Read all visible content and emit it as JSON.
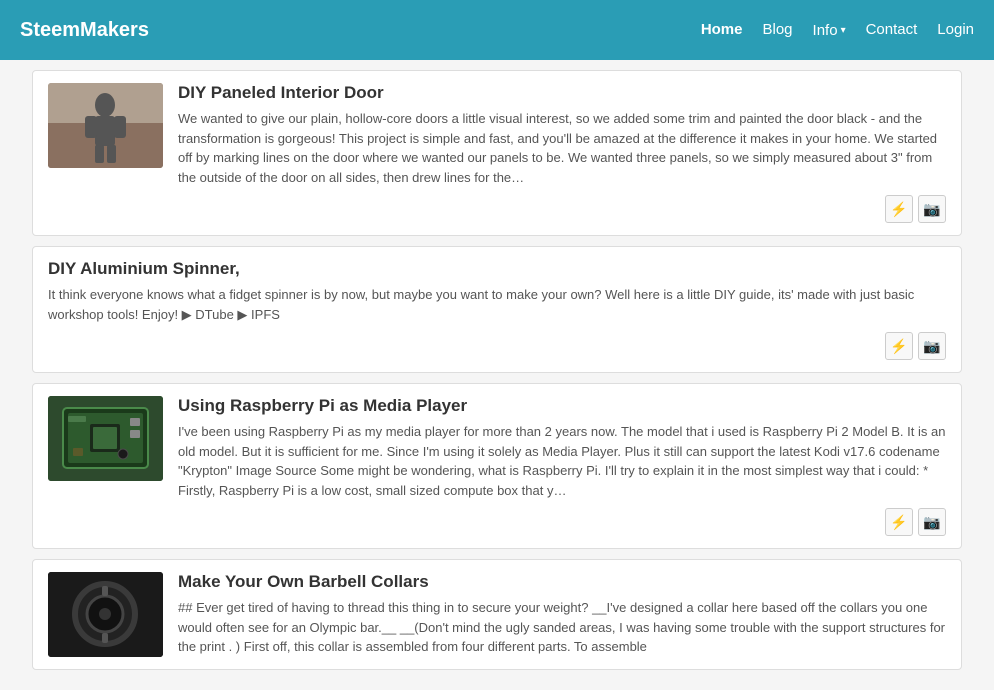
{
  "brand": "SteemMakers",
  "nav": {
    "home": "Home",
    "blog": "Blog",
    "info": "Info",
    "contact": "Contact",
    "login": "Login"
  },
  "posts": [
    {
      "id": "diy-paneled-door",
      "title": "DIY Paneled Interior Door",
      "excerpt": "We wanted to give our plain, hollow-core doors a little visual interest, so we added some trim and painted the door black - and the transformation is gorgeous! This project is simple and fast, and you'll be amazed at the difference it makes in your home. We started off by marking lines on the door where we wanted our panels to be. We wanted three panels, so we simply measured about 3\" from the outside of the door on all sides, then drew lines for the…",
      "has_thumbnail": true,
      "thumbnail_type": "woodwork",
      "actions": [
        "bolt",
        "camera"
      ]
    },
    {
      "id": "diy-aluminium-spinner",
      "title": "DIY Aluminium Spinner,",
      "excerpt": "It think everyone knows what a fidget spinner is by now, but maybe you want to make your own? Well here is a little DIY guide, its' made with just basic workshop tools! Enjoy! ▶ DTube ▶ IPFS",
      "has_thumbnail": false,
      "thumbnail_type": "spinner",
      "actions": [
        "bolt",
        "camera"
      ]
    },
    {
      "id": "raspberry-pi-media-player",
      "title": "Using Raspberry Pi as Media Player",
      "excerpt": "I've been using Raspberry Pi as my media player for more than 2 years now. The model that i used is Raspberry Pi 2 Model B. It is an old model. But it is sufficient for me. Since I'm using it solely as Media Player. Plus it still can support the latest Kodi v17.6 codename \"Krypton\" Image Source Some might be wondering, what is Raspberry Pi. I'll try to explain it in the most simplest way that i could: * Firstly, Raspberry Pi is a low cost, small sized compute box that y…",
      "has_thumbnail": true,
      "thumbnail_type": "raspi",
      "actions": [
        "bolt",
        "camera"
      ]
    },
    {
      "id": "barbell-collars",
      "title": "Make Your Own Barbell Collars",
      "excerpt": "## Ever get tired of having to thread this thing in to secure your weight? __I've designed a collar here based off the collars you one would often see for an Olympic bar.__ __(Don't mind the ugly sanded areas, I was having some trouble with the support structures for the print . ) First off, this collar is assembled from four different parts. To assemble",
      "has_thumbnail": true,
      "thumbnail_type": "barbell",
      "actions": []
    }
  ],
  "icons": {
    "bolt": "⚡",
    "camera": "📷",
    "chevron_down": "▾"
  }
}
